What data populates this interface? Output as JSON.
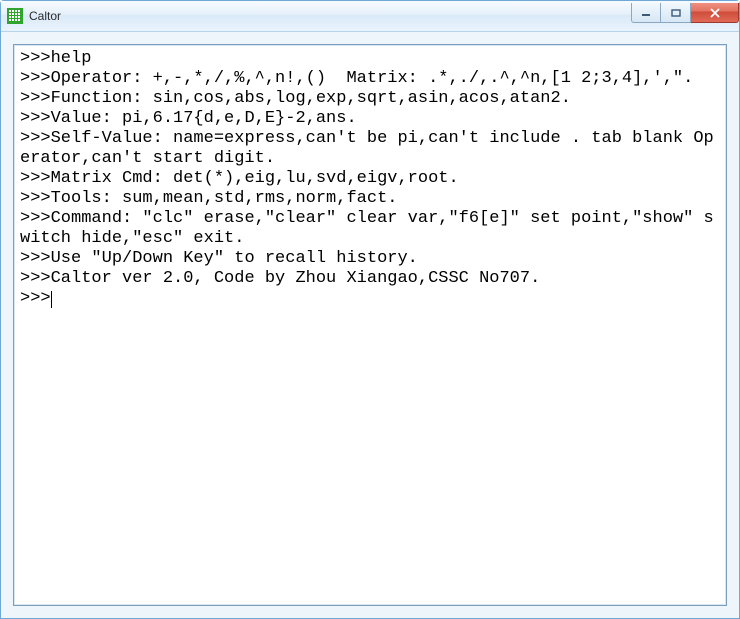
{
  "window": {
    "title": "Caltor",
    "icon": "grid-green-icon",
    "controls": {
      "minimize": "minimize-icon",
      "maximize": "maximize-icon",
      "close": "close-icon"
    }
  },
  "console": {
    "prompt": ">>>",
    "lines": [
      ">>>help",
      ">>>Operator: +,-,*,/,%,^,n!,()  Matrix: .*,./,.^,^n,[1 2;3,4],',\".",
      ">>>Function: sin,cos,abs,log,exp,sqrt,asin,acos,atan2.",
      ">>>Value: pi,6.17{d,e,D,E}-2,ans.",
      ">>>Self-Value: name=express,can't be pi,can't include . tab blank Operator,can't start digit.",
      ">>>Matrix Cmd: det(*),eig,lu,svd,eigv,root.",
      ">>>Tools: sum,mean,std,rms,norm,fact.",
      ">>>Command: \"clc\" erase,\"clear\" clear var,\"f6[e]\" set point,\"show\" switch hide,\"esc\" exit.",
      ">>>Use \"Up/Down Key\" to recall history.",
      ">>>Caltor ver 2.0, Code by Zhou Xiangao,CSSC No707.",
      ">>>"
    ],
    "current_input": ""
  }
}
